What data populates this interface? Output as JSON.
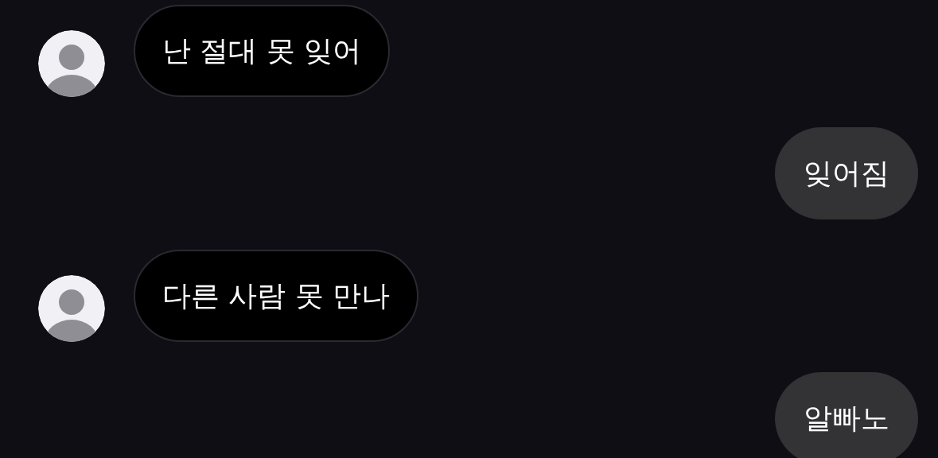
{
  "messages": [
    {
      "kind": "incoming",
      "text": "난 절대 못 잊어"
    },
    {
      "kind": "outgoing",
      "text": "잊어짐"
    },
    {
      "kind": "incoming",
      "text": "다른 사람 못 만나"
    },
    {
      "kind": "outgoing",
      "text": "알빠노"
    }
  ]
}
